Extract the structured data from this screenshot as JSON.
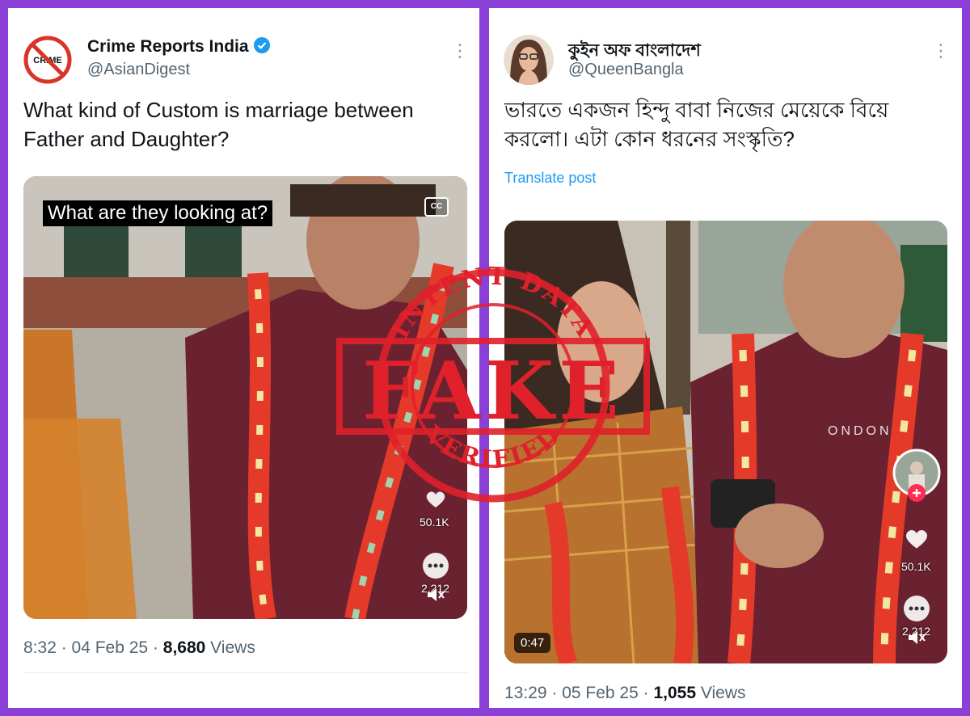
{
  "left_tweet": {
    "display_name": "Crime Reports India",
    "handle": "@AsianDigest",
    "avatar_label": "CRIME",
    "text": "What kind of Custom is marriage between Father and Daughter?",
    "video_caption": "What are they looking at?",
    "cc_label": "CC",
    "likes": "50.1K",
    "comments": "2,212",
    "time_date": "8:32 · 04 Feb 25 · ",
    "views_count": "8,680",
    "views_label": " Views"
  },
  "right_tweet": {
    "display_name": "কুইন অফ বাংলাদেশ",
    "handle": "@QueenBangla",
    "text": "ভারতে একজন হিন্দু বাবা নিজের মেয়েকে বিয়ে করলো। এটা কোন ধরনের সংস্কৃতি?",
    "translate_label": "Translate post",
    "shirt_print": "ONDON",
    "likes": "50.1K",
    "comments": "2,212",
    "duration": "0:47",
    "time_date": "13:29 · 05 Feb 25 · ",
    "views_count": "1,055",
    "views_label": " Views"
  },
  "stamp": {
    "top_text": "INTENT DATA",
    "main_text": "FAKE",
    "bottom_text": "VERIFIED",
    "color": "#e0202a"
  },
  "colors": {
    "frame": "#8a3fd6",
    "link": "#1d9bf0",
    "verified": "#1d9bf0"
  },
  "icons": [
    "more-options-icon",
    "verified-badge-icon",
    "heart-icon",
    "comment-icon",
    "volume-icon",
    "plus-icon"
  ]
}
